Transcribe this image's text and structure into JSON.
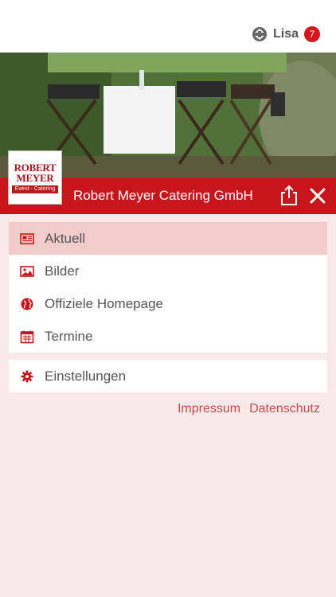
{
  "header": {
    "user_name": "Lisa",
    "notification_count": "7",
    "accent_color": "#d7161b"
  },
  "brand": {
    "title": "Robert Meyer Catering GmbH",
    "logo_line1": "ROBERT",
    "logo_line2": "MEYER",
    "logo_tagline": "Event - Catering",
    "bar_color": "#c8151c"
  },
  "menu": {
    "items": [
      {
        "label": "Aktuell",
        "icon": "newspaper-icon",
        "active": true
      },
      {
        "label": "Bilder",
        "icon": "image-icon",
        "active": false
      },
      {
        "label": "Offiziele Homepage",
        "icon": "globe-icon",
        "active": false
      },
      {
        "label": "Termine",
        "icon": "calendar-icon",
        "active": false
      }
    ],
    "settings": {
      "label": "Einstellungen",
      "icon": "gear-icon"
    }
  },
  "footer": {
    "impressum": "Impressum",
    "datenschutz": "Datenschutz"
  }
}
